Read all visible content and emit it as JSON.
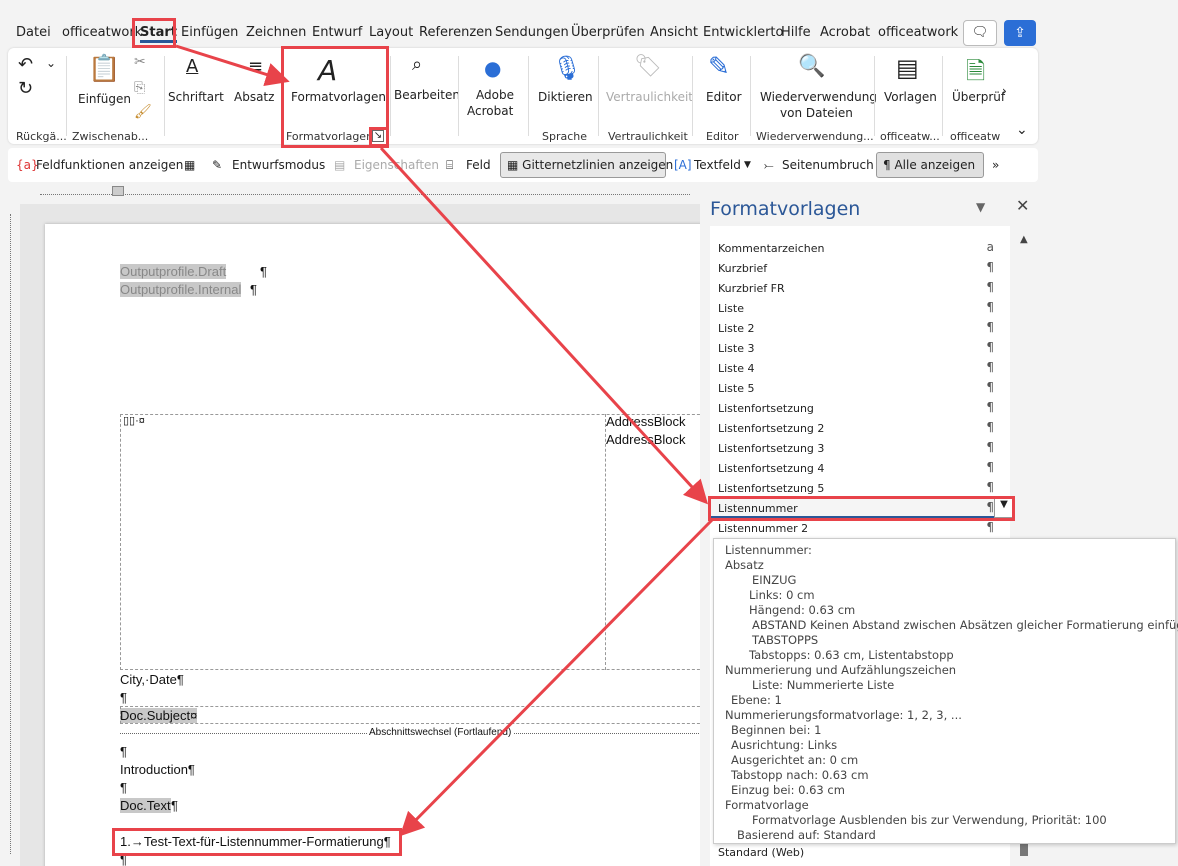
{
  "tabs": [
    "Datei",
    "officeatwork",
    "Start",
    "Einfügen",
    "Zeichnen",
    "Entwurf",
    "Layout",
    "Referenzen",
    "Sendungen",
    "Überprüfen",
    "Ansicht",
    "Entwicklerto",
    "Hilfe",
    "Acrobat",
    "officeatwork"
  ],
  "ribbon": {
    "undo_group": "Rückgä...",
    "clipboard_group": "Zwischenab...",
    "paste": "Einfügen",
    "font": "Schriftart",
    "paragraph": "Absatz",
    "styles": "Formatvorlagen",
    "styles_group": "Formatvorlagen",
    "edit": "Bearbeiten",
    "adobe1": "Adobe",
    "adobe2": "Acrobat",
    "dictate": "Diktieren",
    "language_group": "Sprache",
    "sensitivity": "Vertraulichkeit",
    "sensitivity_group": "Vertraulichkeit",
    "editor": "Editor",
    "editor_group": "Editor",
    "reuse1": "Wiederverwendung",
    "reuse2": "von Dateien",
    "reuse_group": "Wiederverwendung...",
    "templates": "Vorlagen",
    "templates_group": "officeatw...",
    "check": "Überprüf",
    "check_group": "officeatw"
  },
  "qbar": {
    "field_codes": "Feldfunktionen anzeigen",
    "design_mode": "Entwurfsmodus",
    "properties": "Eigenschaften",
    "field": "Feld",
    "gridlines": "Gitternetzlinien anzeigen",
    "textbox": "Textfeld",
    "page_break": "Seitenumbruch",
    "show_all": "Alle anzeigen"
  },
  "doc": {
    "line1": "Outputprofile.Draft",
    "line2": "Outputprofile.Internal",
    "addr1": "AddressBlock",
    "addr2": "AddressBlock",
    "city": "City,·Date¶",
    "pil": "¶",
    "subject": "Doc.Subject",
    "section": "Abschnittswechsel (Fortlaufend)",
    "intro": "Introduction¶",
    "text": "Doc.Text",
    "list": "1.→Test-Text-für-Listennummer-Formatierung"
  },
  "pane": {
    "title": "Formatvorlagen",
    "styles": [
      {
        "name": "Kommentarzeichen",
        "glyph": "a"
      },
      {
        "name": "Kurzbrief",
        "glyph": "¶"
      },
      {
        "name": "Kurzbrief FR",
        "glyph": "¶"
      },
      {
        "name": "Liste",
        "glyph": "¶"
      },
      {
        "name": "Liste 2",
        "glyph": "¶"
      },
      {
        "name": "Liste 3",
        "glyph": "¶"
      },
      {
        "name": "Liste 4",
        "glyph": "¶"
      },
      {
        "name": "Liste 5",
        "glyph": "¶"
      },
      {
        "name": "Listenfortsetzung",
        "glyph": "¶"
      },
      {
        "name": "Listenfortsetzung 2",
        "glyph": "¶"
      },
      {
        "name": "Listenfortsetzung 3",
        "glyph": "¶"
      },
      {
        "name": "Listenfortsetzung 4",
        "glyph": "¶"
      },
      {
        "name": "Listenfortsetzung 5",
        "glyph": "¶"
      },
      {
        "name": "Listennummer",
        "glyph": "¶"
      },
      {
        "name": "Listennummer 2",
        "glyph": "¶"
      }
    ],
    "bottom": "Standard (Web)"
  },
  "tooltip": [
    "Listennummer:",
    "Absatz",
    "EINZUG",
    "Links:  0 cm",
    "Hängend:  0.63 cm",
    "ABSTAND Keinen Abstand zwischen Absätzen gleicher Formatierung einfügen",
    "TABSTOPPS",
    "Tabstopps:  0.63 cm, Listentabstopp",
    "Nummerierung und Aufzählungszeichen",
    "Liste:  Nummerierte Liste",
    "Ebene: 1",
    "Nummerierungsformatvorlage:   1, 2, 3, ...",
    "Beginnen bei: 1",
    "Ausrichtung: Links",
    "Ausgerichtet an:  0 cm",
    "Tabstopp nach:  0.63 cm",
    "Einzug bei:  0.63 cm",
    "Formatvorlage",
    "Formatvorlage Ausblenden bis zur Verwendung, Priorität: 100",
    "Basierend auf: Standard"
  ]
}
